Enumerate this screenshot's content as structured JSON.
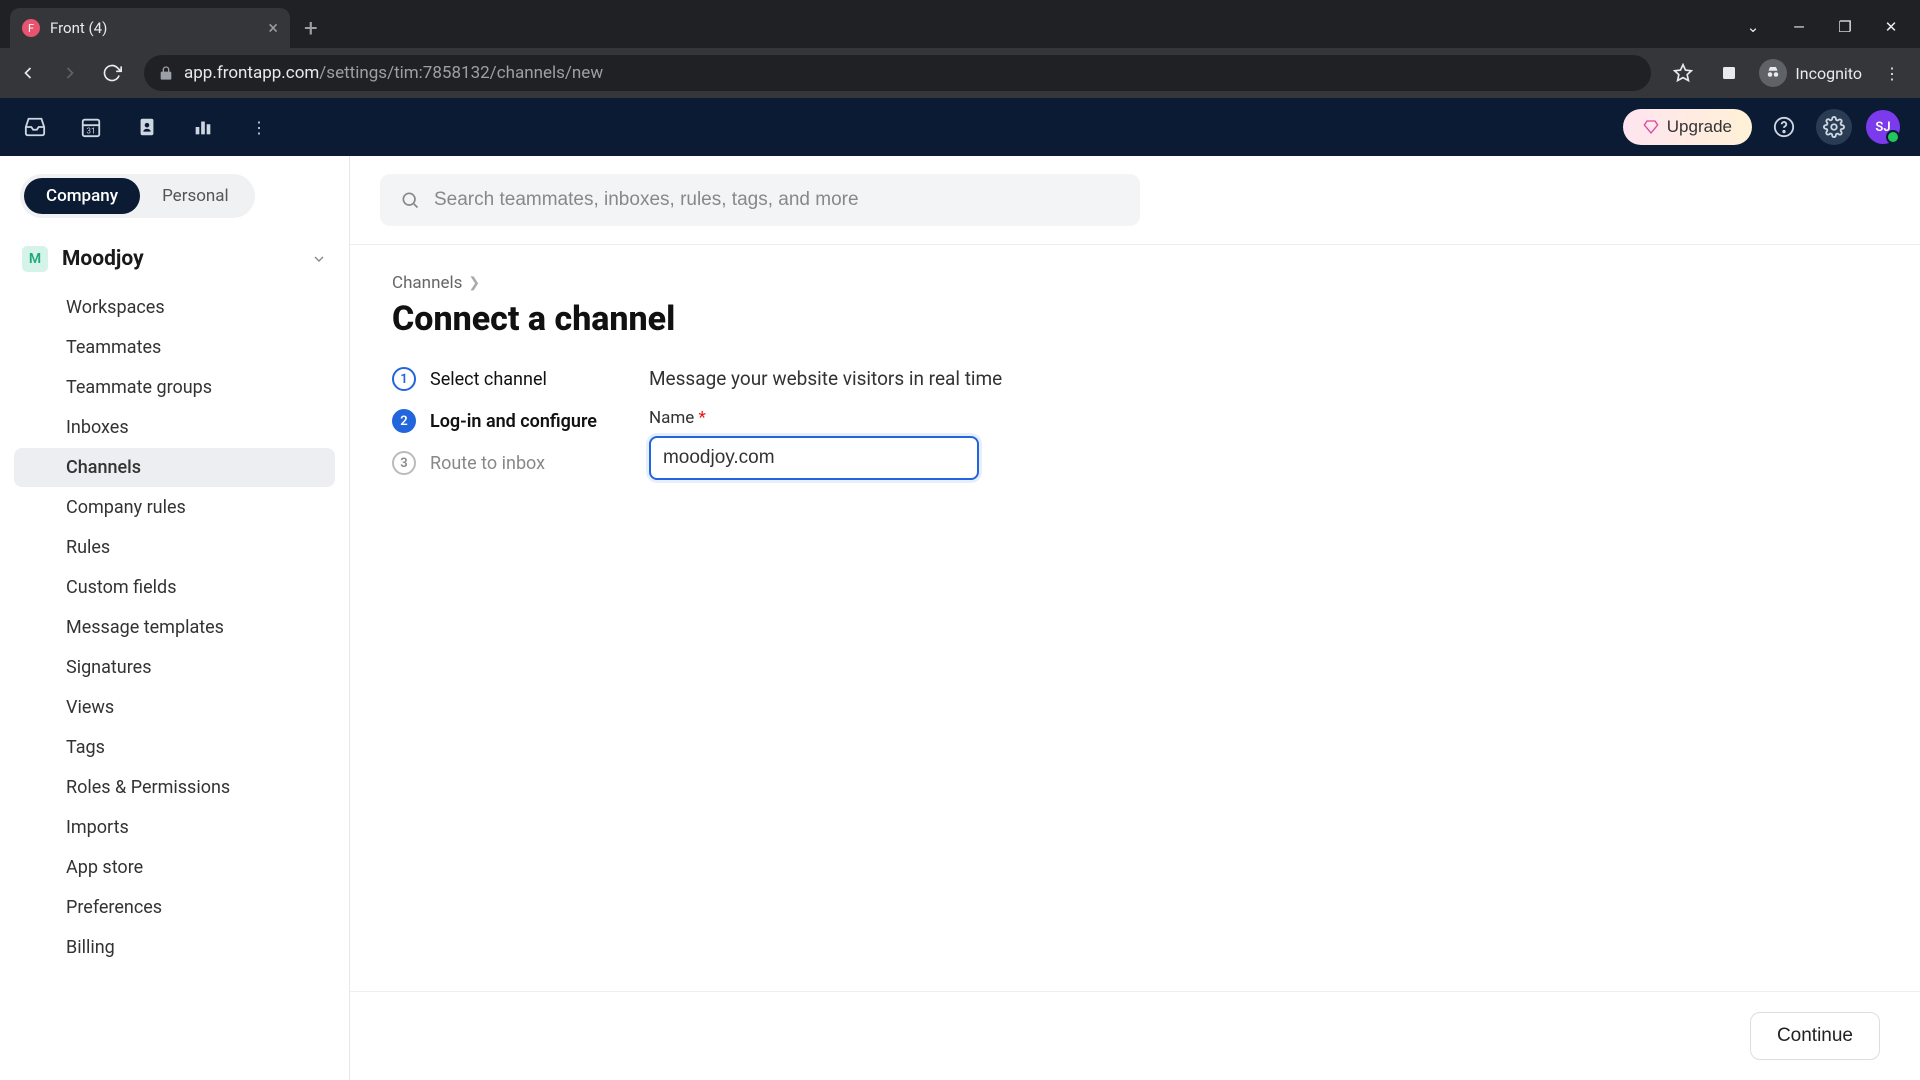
{
  "browser": {
    "tab_title": "Front (4)",
    "url_domain": "app.frontapp.com",
    "url_path": "/settings/tim:7858132/channels/new",
    "incognito_label": "Incognito"
  },
  "appbar": {
    "upgrade_label": "Upgrade",
    "avatar_initials": "SJ"
  },
  "sidebar": {
    "tabs": {
      "company": "Company",
      "personal": "Personal"
    },
    "workspace": {
      "badge": "M",
      "name": "Moodjoy"
    },
    "items": [
      "Workspaces",
      "Teammates",
      "Teammate groups",
      "Inboxes",
      "Channels",
      "Company rules",
      "Rules",
      "Custom fields",
      "Message templates",
      "Signatures",
      "Views",
      "Tags",
      "Roles & Permissions",
      "Imports",
      "App store",
      "Preferences",
      "Billing"
    ],
    "active_index": 4
  },
  "search": {
    "placeholder": "Search teammates, inboxes, rules, tags, and more"
  },
  "page": {
    "breadcrumb": "Channels",
    "title": "Connect a channel",
    "steps": [
      {
        "label": "Select channel",
        "state": "done"
      },
      {
        "label": "Log-in and configure",
        "state": "active"
      },
      {
        "label": "Route to inbox",
        "state": "pending"
      }
    ],
    "description": "Message your website visitors in real time",
    "field_label": "Name",
    "field_value": "moodjoy.com",
    "continue_label": "Continue"
  }
}
